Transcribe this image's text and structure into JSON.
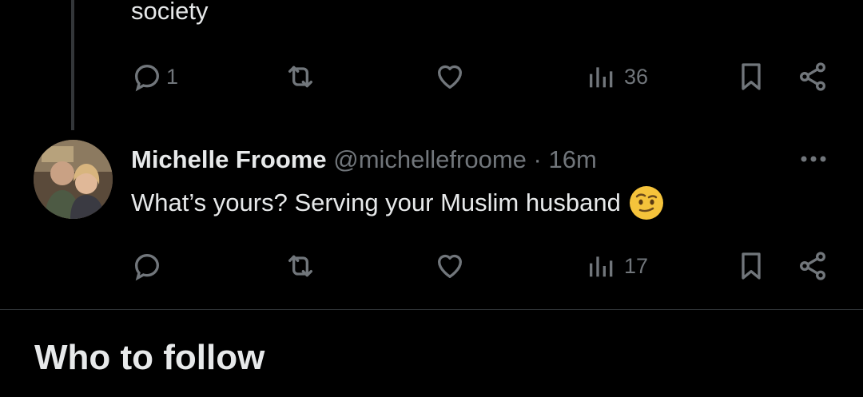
{
  "previous_tweet": {
    "text_tail": "society",
    "actions": {
      "reply_icon": "reply-icon",
      "reply_count": "1",
      "retweet_icon": "retweet-icon",
      "retweet_count": "",
      "like_icon": "heart-icon",
      "like_count": "",
      "views_icon": "views-icon",
      "views_count": "36",
      "bookmark_icon": "bookmark-icon",
      "share_icon": "share-icon"
    }
  },
  "tweet": {
    "author_name": "Michelle Froome",
    "author_handle": "@michellefroome",
    "separator": "·",
    "timestamp": "16m",
    "more_icon": "more-horizontal-icon",
    "text": "What’s yours? Serving your Muslim husband",
    "emoji": "face-with-raised-eyebrow-emoji",
    "actions": {
      "reply_icon": "reply-icon",
      "reply_count": "",
      "retweet_icon": "retweet-icon",
      "retweet_count": "",
      "like_icon": "heart-icon",
      "like_count": "",
      "views_icon": "views-icon",
      "views_count": "17",
      "bookmark_icon": "bookmark-icon",
      "share_icon": "share-icon"
    }
  },
  "who_to_follow": {
    "title": "Who to follow"
  },
  "colors": {
    "background": "#000000",
    "primary_text": "#e7e9ea",
    "secondary_text": "#71767b",
    "divider": "#2f3336",
    "thread_line": "#333639"
  }
}
